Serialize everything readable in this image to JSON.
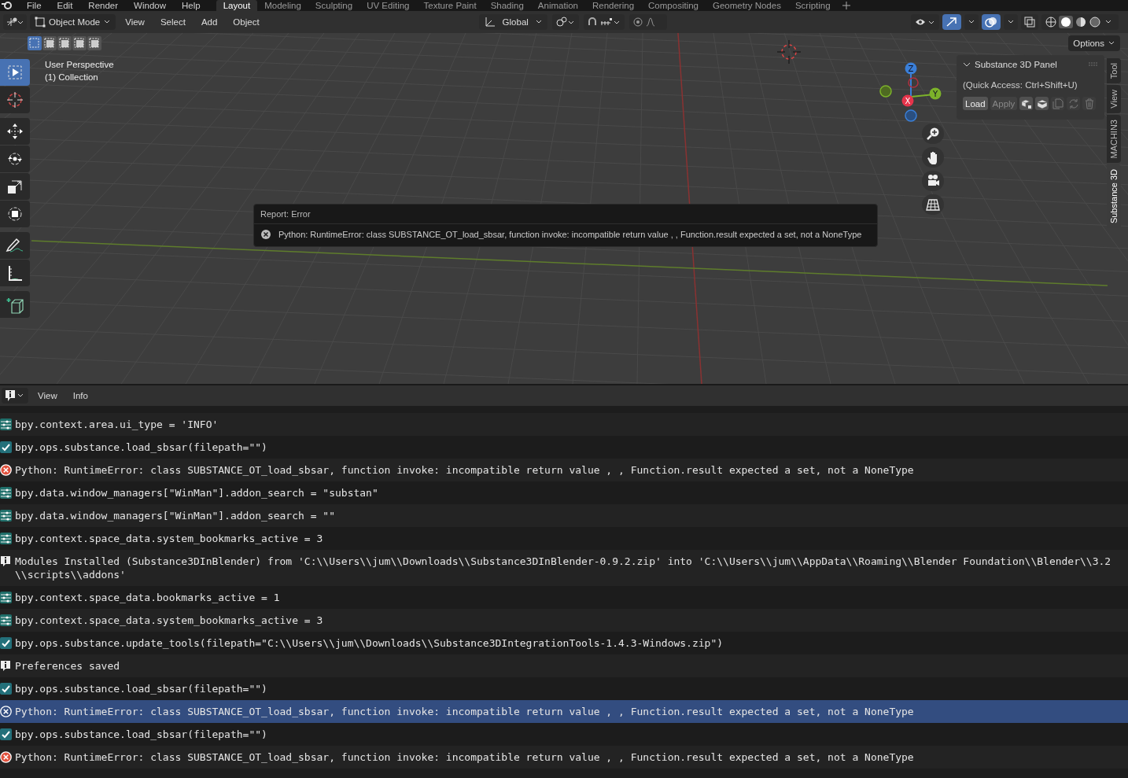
{
  "menu": [
    "File",
    "Edit",
    "Render",
    "Window",
    "Help"
  ],
  "workspaces": [
    {
      "label": "Layout",
      "selected": true
    },
    {
      "label": "Modeling",
      "selected": false
    },
    {
      "label": "Sculpting",
      "selected": false
    },
    {
      "label": "UV Editing",
      "selected": false
    },
    {
      "label": "Texture Paint",
      "selected": false
    },
    {
      "label": "Shading",
      "selected": false
    },
    {
      "label": "Animation",
      "selected": false
    },
    {
      "label": "Rendering",
      "selected": false
    },
    {
      "label": "Compositing",
      "selected": false
    },
    {
      "label": "Geometry Nodes",
      "selected": false
    },
    {
      "label": "Scripting",
      "selected": false
    }
  ],
  "header": {
    "mode": "Object Mode",
    "menus": [
      "View",
      "Select",
      "Add",
      "Object"
    ],
    "orientation": "Global",
    "snap_on": false,
    "proportional_on": false,
    "options": "Options"
  },
  "viewport": {
    "perspective": "User Perspective",
    "collection": "(1) Collection",
    "gizmo_axes": [
      "Z",
      "Y",
      "X"
    ]
  },
  "tools": [
    {
      "kind": "select",
      "selected": true
    },
    {
      "kind": "cursor",
      "selected": false
    },
    {
      "kind": "move",
      "selected": false
    },
    {
      "kind": "rotate",
      "selected": false
    },
    {
      "kind": "scale",
      "selected": false
    },
    {
      "kind": "transform",
      "selected": false
    },
    {
      "kind": "annotate",
      "selected": false
    },
    {
      "kind": "measure",
      "selected": false
    },
    {
      "kind": "add_cube",
      "selected": false
    }
  ],
  "panel": {
    "title": "Substance 3D Panel",
    "hint": "(Quick Access: Ctrl+Shift+U)",
    "buttons": [
      {
        "label": "Load",
        "disabled": false
      },
      {
        "label": "Apply",
        "disabled": true
      }
    ]
  },
  "side_tabs": [
    {
      "label": "Tool",
      "selected": false
    },
    {
      "label": "View",
      "selected": false
    },
    {
      "label": "MACHIN3",
      "selected": false
    },
    {
      "label": "Substance 3D",
      "selected": true
    }
  ],
  "report": {
    "title": "Report: Error",
    "message": "Python: RuntimeError: class SUBSTANCE_OT_load_sbsar, function invoke: incompatible return value , , Function.result expected a set, not a NoneType"
  },
  "info_header": {
    "menus": [
      "View",
      "Info"
    ]
  },
  "log": [
    {
      "kind": "property",
      "text": "bpy.context.area.ui_type = 'INFO'",
      "selected": false
    },
    {
      "kind": "operator",
      "text": "bpy.ops.substance.load_sbsar(filepath=\"\")",
      "selected": false
    },
    {
      "kind": "error",
      "text": "Python: RuntimeError: class SUBSTANCE_OT_load_sbsar, function invoke: incompatible return value , , Function.result expected a set, not a NoneType",
      "selected": false
    },
    {
      "kind": "property",
      "text": "bpy.data.window_managers[\"WinMan\"].addon_search = \"substan\"",
      "selected": false
    },
    {
      "kind": "property",
      "text": "bpy.data.window_managers[\"WinMan\"].addon_search = \"\"",
      "selected": false
    },
    {
      "kind": "property",
      "text": "bpy.context.space_data.system_bookmarks_active = 3",
      "selected": false
    },
    {
      "kind": "info",
      "text": "Modules Installed (Substance3DInBlender) from 'C:\\\\Users\\\\jum\\\\Downloads\\\\Substance3DInBlender-0.9.2.zip' into 'C:\\\\Users\\\\jum\\\\AppData\\\\Roaming\\\\Blender Foundation\\\\Blender\\\\3.2\\\\scripts\\\\addons'",
      "selected": false
    },
    {
      "kind": "property",
      "text": "bpy.context.space_data.bookmarks_active = 1",
      "selected": false
    },
    {
      "kind": "property",
      "text": "bpy.context.space_data.system_bookmarks_active = 3",
      "selected": false
    },
    {
      "kind": "operator",
      "text": "bpy.ops.substance.update_tools(filepath=\"C:\\\\Users\\\\jum\\\\Downloads\\\\Substance3DIntegrationTools-1.4.3-Windows.zip\")",
      "selected": false
    },
    {
      "kind": "info",
      "text": "Preferences saved",
      "selected": false
    },
    {
      "kind": "operator",
      "text": "bpy.ops.substance.load_sbsar(filepath=\"\")",
      "selected": false
    },
    {
      "kind": "error",
      "text": "Python: RuntimeError: class SUBSTANCE_OT_load_sbsar, function invoke: incompatible return value , , Function.result expected a set, not a NoneType",
      "selected": true
    },
    {
      "kind": "operator",
      "text": "bpy.ops.substance.load_sbsar(filepath=\"\")",
      "selected": false
    },
    {
      "kind": "error",
      "text": "Python: RuntimeError: class SUBSTANCE_OT_load_sbsar, function invoke: incompatible return value , , Function.result expected a set, not a NoneType",
      "selected": false
    }
  ]
}
